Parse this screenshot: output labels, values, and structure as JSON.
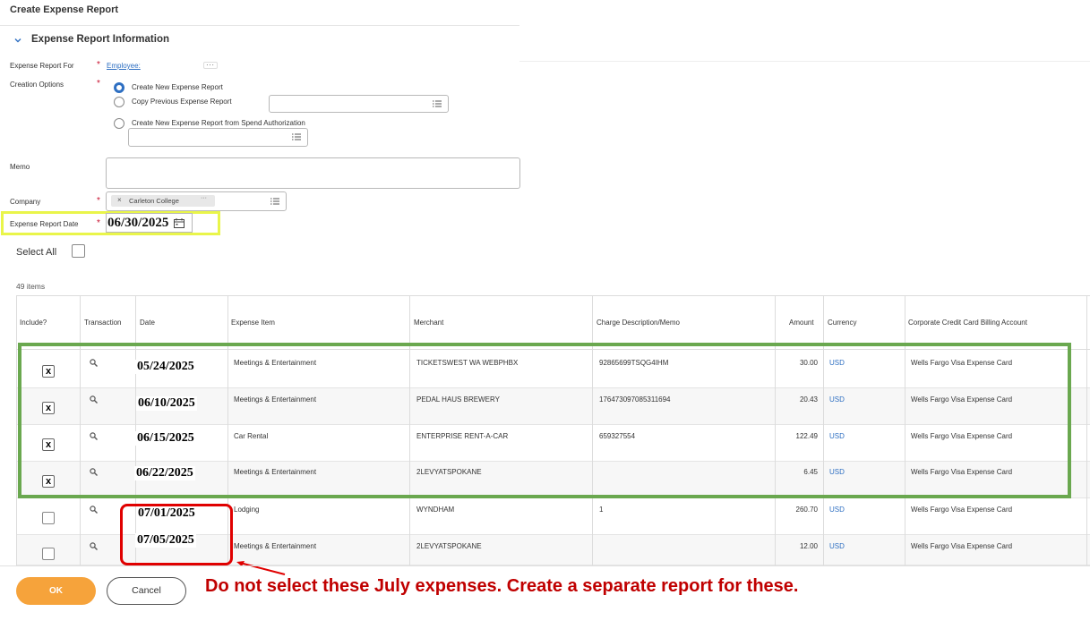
{
  "page": {
    "title": "Create Expense Report"
  },
  "section": {
    "title": "Expense Report Information"
  },
  "form": {
    "report_for": {
      "label": "Expense Report For",
      "required": "*",
      "value": "Employee:",
      "more": "···"
    },
    "creation_options": {
      "label": "Creation Options",
      "required": "*",
      "options": [
        {
          "label": "Create New Expense Report",
          "selected": true
        },
        {
          "label": "Copy Previous Expense Report",
          "selected": false
        },
        {
          "label": "Create New Expense Report from Spend Authorization",
          "selected": false
        }
      ]
    },
    "memo": {
      "label": "Memo"
    },
    "company": {
      "label": "Company",
      "required": "*",
      "value": "Carleton College",
      "remove": "×",
      "more": "···"
    },
    "report_date": {
      "label": "Expense Report Date",
      "required": "*",
      "value": "06/30/2025"
    }
  },
  "select_all": {
    "label": "Select All"
  },
  "items_count": "49 items",
  "table": {
    "headers": [
      "Include?",
      "Transaction",
      "Date",
      "Expense Item",
      "Merchant",
      "Charge Description/Memo",
      "Amount",
      "Currency",
      "Corporate Credit Card Billing Account"
    ],
    "rows": [
      {
        "include": "x",
        "date": "05/24/2025",
        "expense_item": "Meetings & Entertainment",
        "merchant": "TICKETSWEST WA WEBPHBX",
        "memo": "92865699TSQG4IHM",
        "amount": "30.00",
        "currency": "USD",
        "account": "Wells Fargo Visa Expense Card"
      },
      {
        "include": "x",
        "date": "06/10/2025",
        "expense_item": "Meetings & Entertainment",
        "merchant": "PEDAL HAUS BREWERY",
        "memo": "176473097085311694",
        "amount": "20.43",
        "currency": "USD",
        "account": "Wells Fargo Visa Expense Card"
      },
      {
        "include": "x",
        "date": "06/15/2025",
        "expense_item": "Car Rental",
        "merchant": "ENTERPRISE RENT-A-CAR",
        "memo": "659327554",
        "amount": "122.49",
        "currency": "USD",
        "account": "Wells Fargo Visa Expense Card"
      },
      {
        "include": "x",
        "date": "06/22/2025",
        "expense_item": "Meetings & Entertainment",
        "merchant": "2LEVYATSPOKANE",
        "memo": "",
        "amount": "6.45",
        "currency": "USD",
        "account": "Wells Fargo Visa Expense Card"
      },
      {
        "include": "",
        "date": "07/01/2025",
        "expense_item": "Lodging",
        "merchant": "WYNDHAM",
        "memo": "1",
        "amount": "260.70",
        "currency": "USD",
        "account": "Wells Fargo Visa Expense Card"
      },
      {
        "include": "",
        "date": "07/05/2025",
        "expense_item": "Meetings & Entertainment",
        "merchant": "2LEVYATSPOKANE",
        "memo": "",
        "amount": "12.00",
        "currency": "USD",
        "account": "Wells Fargo Visa Expense Card"
      }
    ]
  },
  "footer": {
    "ok_label": "OK",
    "cancel_label": "Cancel"
  },
  "annotation": {
    "note": "Do not select these July expenses. Create a separate report for these."
  },
  "colors": {
    "accent_blue": "#2e6fc2",
    "ok_orange": "#f6a33b",
    "required_red": "#c8102e",
    "date_highlight": "#e9f54a",
    "green_box": "#6aa84f",
    "red_box": "#e00000",
    "note_red": "#c00000"
  },
  "icons": [
    "chevron-down-icon",
    "list-icon",
    "calendar-icon",
    "magnifier-icon",
    "arrow-icon"
  ]
}
